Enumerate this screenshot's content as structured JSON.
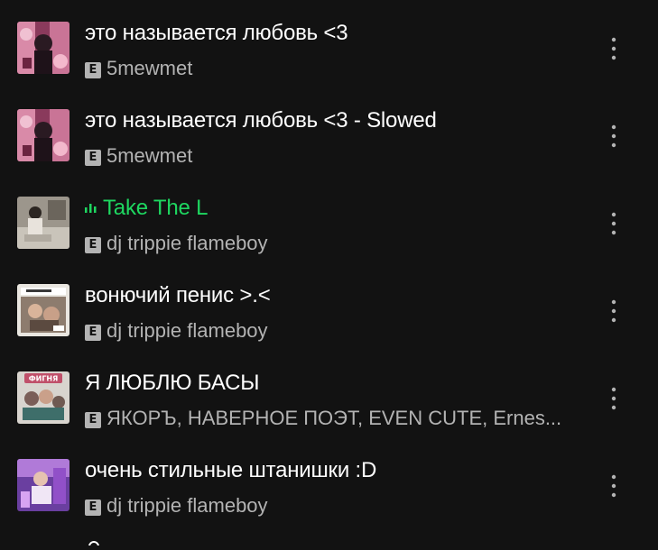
{
  "tracks": [
    {
      "title": "это называется любовь <3",
      "explicit": "E",
      "artist": "5mewmet",
      "playing": false,
      "cover_icon": "album-art-pink-collage"
    },
    {
      "title": "это называется любовь <3 - Slowed",
      "explicit": "E",
      "artist": "5mewmet",
      "playing": false,
      "cover_icon": "album-art-pink-collage"
    },
    {
      "title": "Take The L",
      "explicit": "E",
      "artist": "dj trippie flameboy",
      "playing": true,
      "cover_icon": "album-art-photo-room"
    },
    {
      "title": "вонючий пенис >.<",
      "explicit": "E",
      "artist": "dj trippie flameboy",
      "playing": false,
      "cover_icon": "album-art-photo-faces"
    },
    {
      "title": "Я ЛЮБЛЮ БАСЫ",
      "explicit": "E",
      "artist": "ЯКОРЪ, НАВЕРНОЕ ПОЭТ, EVEN CUTE, Ernes...",
      "playing": false,
      "cover_icon": "album-art-figna-collage",
      "cover_text": "ФИГНЯ"
    },
    {
      "title": "очень стильные штанишки :D",
      "explicit": "E",
      "artist": "dj trippie flameboy",
      "playing": false,
      "cover_icon": "album-art-purple-photo"
    }
  ],
  "colors": {
    "background": "#121212",
    "title": "#ffffff",
    "subtitle": "#b3b3b3",
    "playing": "#1ed760"
  },
  "icons": {
    "more": "more-vertical-icon",
    "playing": "equalizer-icon",
    "explicit": "explicit-badge"
  }
}
